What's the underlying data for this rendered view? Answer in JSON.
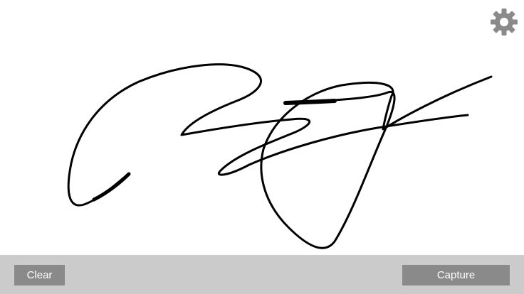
{
  "app": {
    "settings_icon": "gear-icon",
    "colors": {
      "canvas_background": "#ffffff",
      "ink": "#000000",
      "toolbar_background": "#cbcbcb",
      "button_background": "#8a8a8a",
      "button_text": "#ffffff",
      "icon": "#8a8a8a"
    }
  },
  "toolbar": {
    "clear_label": "Clear",
    "capture_label": "Capture"
  }
}
